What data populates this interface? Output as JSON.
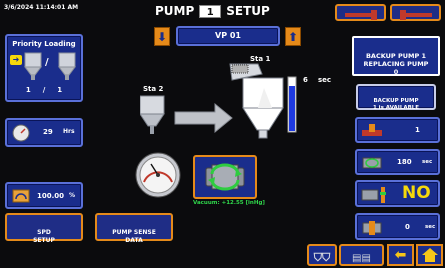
{
  "header": {
    "datetime": "3/6/2024 11:14:01 AM",
    "title_prefix": "PUMP",
    "pump_number": "1",
    "title_suffix": "SETUP"
  },
  "station_selector": {
    "value": "VP 01"
  },
  "priority_loading": {
    "title": "Priority Loading",
    "slash": "/",
    "left_value": "1",
    "mid": "/",
    "right_value": "1"
  },
  "hours": {
    "value": "29",
    "unit": "Hrs"
  },
  "speed": {
    "value": "100.00",
    "unit": "%"
  },
  "bottom_buttons": {
    "spd_setup": "SPD\nSETUP",
    "pump_sense": "PUMP SENSE\nDATA"
  },
  "diagram": {
    "sta1_label": "Sta 1",
    "sta2_label": "Sta 2",
    "level_value": "6",
    "level_unit": "sec",
    "level_fraction": 0.85
  },
  "vacuum": {
    "text": "Vacuum: +12.55 [inHg]"
  },
  "right_panel": {
    "backup_replacing": "BACKUP PUMP 1\nREPLACING PUMP\n0",
    "backup_available": "BACKUP PUMP\n1 is AVAILABLE",
    "tag_value": "1",
    "timer_value": "180",
    "timer_unit": "sec",
    "flag_value": "NO",
    "last_value": "0",
    "last_unit": "sec"
  },
  "colors": {
    "navy": "#1a2d8c",
    "orange": "#e58a1a",
    "yellow_no": "#f5d80a",
    "vacuum_text": "#2fd64a"
  }
}
